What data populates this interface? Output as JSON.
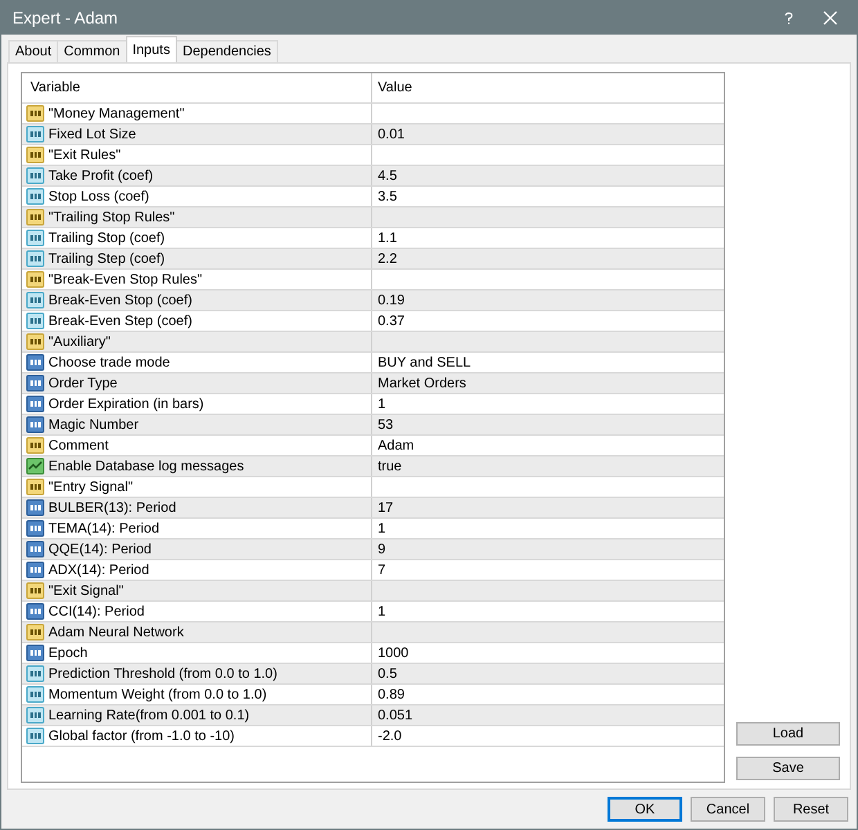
{
  "window": {
    "title": "Expert - Adam"
  },
  "tabs": [
    {
      "label": "About",
      "selected": false
    },
    {
      "label": "Common",
      "selected": false
    },
    {
      "label": "Inputs",
      "selected": true
    },
    {
      "label": "Dependencies",
      "selected": false
    }
  ],
  "table": {
    "columns": [
      "Variable",
      "Value"
    ],
    "rows": [
      {
        "kind": "string",
        "variable": "\"Money Management\"",
        "value": ""
      },
      {
        "kind": "double",
        "variable": "Fixed Lot Size",
        "value": "0.01"
      },
      {
        "kind": "string",
        "variable": "\"Exit Rules\"",
        "value": ""
      },
      {
        "kind": "double",
        "variable": "Take Profit (coef)",
        "value": "4.5"
      },
      {
        "kind": "double",
        "variable": "Stop Loss (coef)",
        "value": "3.5"
      },
      {
        "kind": "string",
        "variable": "\"Trailing Stop Rules\"",
        "value": ""
      },
      {
        "kind": "double",
        "variable": "Trailing Stop (coef)",
        "value": "1.1"
      },
      {
        "kind": "double",
        "variable": "Trailing Step (coef)",
        "value": "2.2"
      },
      {
        "kind": "string",
        "variable": "\"Break-Even Stop Rules\"",
        "value": ""
      },
      {
        "kind": "double",
        "variable": "Break-Even Stop (coef)",
        "value": "0.19"
      },
      {
        "kind": "double",
        "variable": "Break-Even Step (coef)",
        "value": "0.37"
      },
      {
        "kind": "string",
        "variable": "\"Auxiliary\"",
        "value": ""
      },
      {
        "kind": "integer",
        "variable": "Choose trade mode",
        "value": "BUY and SELL"
      },
      {
        "kind": "integer",
        "variable": "Order Type",
        "value": "Market Orders"
      },
      {
        "kind": "integer",
        "variable": "Order Expiration (in bars)",
        "value": "1"
      },
      {
        "kind": "integer",
        "variable": "Magic Number",
        "value": "53"
      },
      {
        "kind": "string",
        "variable": "Comment",
        "value": "Adam"
      },
      {
        "kind": "bool",
        "variable": "Enable Database log messages",
        "value": "true"
      },
      {
        "kind": "string",
        "variable": "\"Entry Signal\"",
        "value": ""
      },
      {
        "kind": "integer",
        "variable": "BULBER(13): Period",
        "value": "17"
      },
      {
        "kind": "integer",
        "variable": "TEMA(14): Period",
        "value": "1"
      },
      {
        "kind": "integer",
        "variable": "QQE(14):  Period",
        "value": "9"
      },
      {
        "kind": "integer",
        "variable": "ADX(14):  Period",
        "value": "7"
      },
      {
        "kind": "string",
        "variable": "\"Exit Signal\"",
        "value": ""
      },
      {
        "kind": "integer",
        "variable": "CCI(14):  Period",
        "value": "1"
      },
      {
        "kind": "string",
        "variable": "Adam Neural Network",
        "value": ""
      },
      {
        "kind": "integer",
        "variable": "Epoch",
        "value": "1000"
      },
      {
        "kind": "double",
        "variable": "Prediction Threshold (from 0.0 to 1.0)",
        "value": "0.5"
      },
      {
        "kind": "double",
        "variable": "Momentum Weight (from  0.0 to 1.0)",
        "value": "0.89"
      },
      {
        "kind": "double",
        "variable": "Learning Rate(from 0.001 to 0.1)",
        "value": "0.051"
      },
      {
        "kind": "double",
        "variable": "Global factor (from  -1.0 to -10)",
        "value": "-2.0"
      }
    ]
  },
  "side_buttons": [
    "Load",
    "Save"
  ],
  "buttons": [
    {
      "label": "OK",
      "focused": true
    },
    {
      "label": "Cancel",
      "focused": false
    },
    {
      "label": "Reset",
      "focused": false
    }
  ]
}
